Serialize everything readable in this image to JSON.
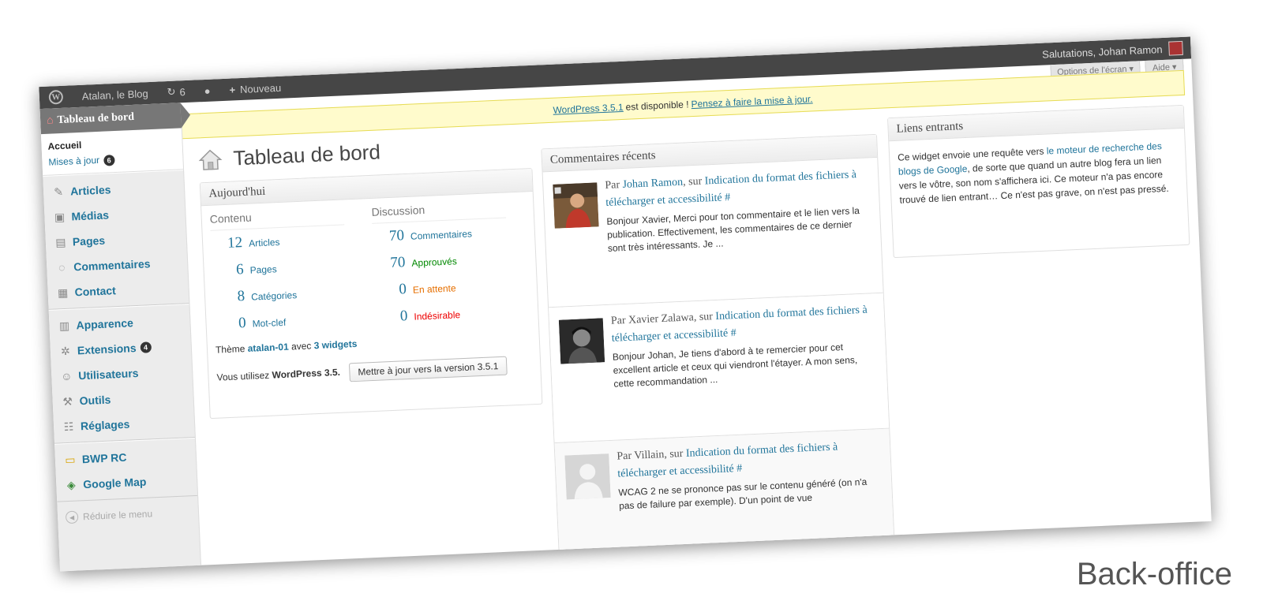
{
  "caption": "Back-office",
  "adminbar": {
    "site_name": "Atalan, le Blog",
    "updates_count": "6",
    "new_label": "Nouveau",
    "greeting": "Salutations, Johan Ramon"
  },
  "screen_options": {
    "options_label": "Options de l'écran ▾",
    "help_label": "Aide ▾"
  },
  "notice": {
    "link_version": "WordPress 3.5.1",
    "text": "est disponible !",
    "link_update": "Pensez à faire la mise à jour."
  },
  "sidebar": {
    "current": "Tableau de bord",
    "sub_home": "Accueil",
    "sub_updates": "Mises à jour",
    "sub_updates_count": "6",
    "items": [
      {
        "label": "Articles",
        "icon": "✎"
      },
      {
        "label": "Médias",
        "icon": "▣"
      },
      {
        "label": "Pages",
        "icon": "▤"
      },
      {
        "label": "Commentaires",
        "icon": "◌"
      },
      {
        "label": "Contact",
        "icon": "▦"
      },
      {
        "label": "Apparence",
        "icon": "▥"
      },
      {
        "label": "Extensions",
        "icon": "✲",
        "count": "4"
      },
      {
        "label": "Utilisateurs",
        "icon": "☺"
      },
      {
        "label": "Outils",
        "icon": "⚒"
      },
      {
        "label": "Réglages",
        "icon": "☷"
      },
      {
        "label": "BWP RC",
        "icon": "▭"
      },
      {
        "label": "Google Map",
        "icon": "◈"
      }
    ],
    "collapse_label": "Réduire le menu"
  },
  "page_title": "Tableau de bord",
  "today": {
    "title": "Aujourd'hui",
    "content_header": "Contenu",
    "discussion_header": "Discussion",
    "content": [
      {
        "num": "12",
        "label": "Articles"
      },
      {
        "num": "6",
        "label": "Pages"
      },
      {
        "num": "8",
        "label": "Catégories"
      },
      {
        "num": "0",
        "label": "Mot-clef"
      }
    ],
    "discussion": [
      {
        "num": "70",
        "label": "Commentaires",
        "color": "#21759b"
      },
      {
        "num": "70",
        "label": "Approuvés",
        "color": "#008800"
      },
      {
        "num": "0",
        "label": "En attente",
        "color": "#e66f00"
      },
      {
        "num": "0",
        "label": "Indésirable",
        "color": "#ee0000"
      }
    ],
    "theme_prefix": "Thème",
    "theme_name": "atalan-01",
    "theme_with": "avec",
    "widgets_link": "3 widgets",
    "version_text": "Vous utilisez",
    "version_name": "WordPress 3.5.",
    "update_button": "Mettre à jour vers la version 3.5.1"
  },
  "comments": {
    "title": "Commentaires récents",
    "items": [
      {
        "prefix": "Par",
        "author": "Johan Ramon",
        "on": ", sur",
        "post": "Indication du format des fichiers à télécharger et accessibilité",
        "hash": "#",
        "text": "Bonjour Xavier, Merci pour ton commentaire et le lien vers la publication. Effectivement, les commentaires de ce dernier sont très intéressants. Je ..."
      },
      {
        "prefix": "Par",
        "author": "Xavier Zalawa",
        "on": ", sur",
        "post": "Indication du format des fichiers à télécharger et accessibilité",
        "hash": "#",
        "text": "Bonjour Johan, Je tiens d'abord à te remercier pour cet excellent article et ceux qui viendront l'étayer. A mon sens, cette recommandation ..."
      },
      {
        "prefix": "Par",
        "author": "Villain",
        "on": ", sur",
        "post": "Indication du format des fichiers à télécharger et accessibilité",
        "hash": "#",
        "text": "WCAG 2 ne se prononce pas sur le contenu généré (on n'a pas de failure par exemple). D'un point de vue"
      }
    ]
  },
  "links": {
    "title": "Liens entrants",
    "text_before": "Ce widget envoie une requête vers",
    "link": "le moteur de recherche des blogs de Google",
    "text_after": ", de sorte que quand un autre blog fera un lien vers le vôtre, son nom s'affichera ici. Ce moteur n'a pas encore trouvé de lien entrant… Ce n'est pas grave, on n'est pas pressé."
  }
}
